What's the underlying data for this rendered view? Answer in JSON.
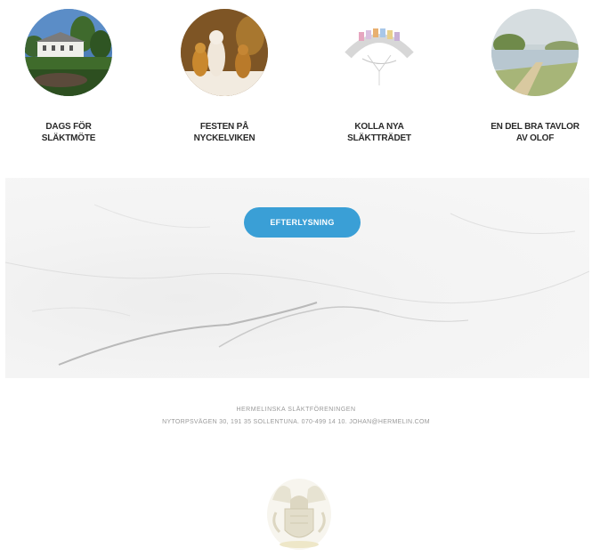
{
  "features": [
    {
      "line1": "DAGS FÖR",
      "line2": "SLÄKTMÖTE",
      "image": "manor-house-photo"
    },
    {
      "line1": "FESTEN PÅ",
      "line2": "NYCKELVIKEN",
      "image": "ermine-figurines-photo"
    },
    {
      "line1": "KOLLA NYA",
      "line2": "SLÄKTTRÄDET",
      "image": "family-tree-drawing"
    },
    {
      "line1": "EN DEL BRA TAVLOR",
      "line2": "AV OLOF",
      "image": "landscape-painting"
    }
  ],
  "cta": {
    "label": "EFTERLYSNING",
    "color": "#3a9fd6"
  },
  "footer": {
    "org": "HERMELINSKA SLÄKTFÖRENINGEN",
    "address": "NYTORPSVÄGEN 30, 191 35 SOLLENTUNA. 070-499 14 10. JOHAN@HERMELIN.COM"
  },
  "crest": "family-crest-logo"
}
